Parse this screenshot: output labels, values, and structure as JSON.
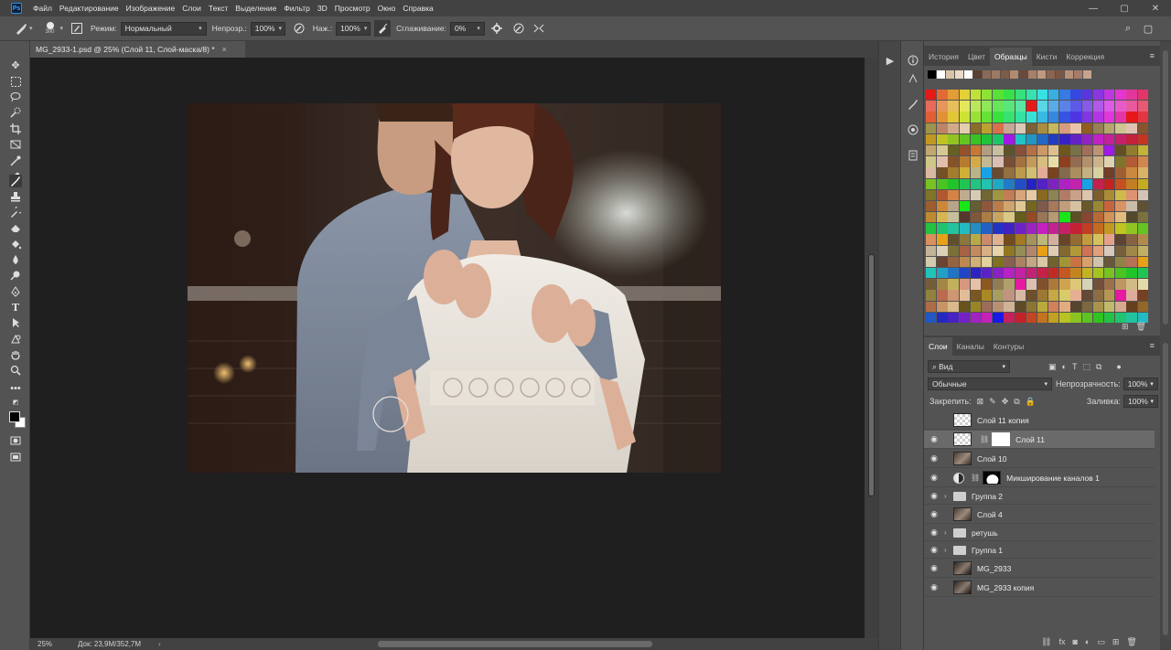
{
  "menubar": {
    "items": [
      "Файл",
      "Редактирование",
      "Изображение",
      "Слои",
      "Текст",
      "Выделение",
      "Фильтр",
      "3D",
      "Просмотр",
      "Окно",
      "Справка"
    ],
    "logo": "Ps"
  },
  "options": {
    "brush_size": "300",
    "mode_label": "Режим:",
    "mode_value": "Нормальный",
    "opacity_label": "Непрозр.:",
    "opacity_value": "100%",
    "pressure_label": "Наж.:",
    "pressure_value": "100%",
    "smoothing_label": "Сглаживание:",
    "smoothing_value": "0%"
  },
  "document": {
    "tab_title": "MG_2933-1.psd @ 25% (Слой 11, Слой-маска/8) *",
    "close": "×"
  },
  "status": {
    "zoom": "25%",
    "doc": "Док: 23,9M/352,7M",
    "arrow": "›"
  },
  "swatches_panel": {
    "tabs": [
      "История",
      "Цвет",
      "Образцы",
      "Кисти",
      "Коррекция"
    ],
    "active_tab": "Образцы",
    "recent_colors": [
      "#000000",
      "#ffffff",
      "#d9c2a8",
      "#e8d9c8",
      "#ffffff",
      "#5a4032",
      "#8a6a58",
      "#9c7a64",
      "#7c5c48",
      "#b08a70",
      "#6a4a3a",
      "#a88068",
      "#c09880",
      "#8c6450",
      "#7a5644",
      "#b89078",
      "#a47c68",
      "#c8a490"
    ]
  },
  "layers_panel": {
    "tabs": [
      "Слои",
      "Каналы",
      "Контуры"
    ],
    "active_tab": "Слои",
    "filter_kind": "Вид",
    "blend_mode": "Обычные",
    "opacity_label": "Непрозрачность:",
    "opacity_value": "100%",
    "lock_label": "Закрепить:",
    "fill_label": "Заливка:",
    "fill_value": "100%",
    "layers": [
      {
        "name": "Слой 11 копия",
        "visible": false,
        "thumb": "check",
        "type": "pixel",
        "selected": false
      },
      {
        "name": "Слой 11",
        "visible": true,
        "thumb": "check",
        "type": "pixel-mask",
        "selected": true
      },
      {
        "name": "Слой 10",
        "visible": true,
        "thumb": "photo",
        "type": "pixel",
        "selected": false
      },
      {
        "name": "Микширование каналов 1",
        "visible": true,
        "thumb": "mask-silhouette",
        "type": "adjustment",
        "selected": false
      },
      {
        "name": "Группа 2",
        "visible": true,
        "thumb": "",
        "type": "group",
        "selected": false
      },
      {
        "name": "Слой 4",
        "visible": true,
        "thumb": "photo",
        "type": "pixel",
        "selected": false
      },
      {
        "name": "ретушь",
        "visible": true,
        "thumb": "",
        "type": "group",
        "selected": false
      },
      {
        "name": "Группа 1",
        "visible": true,
        "thumb": "",
        "type": "group",
        "selected": false
      },
      {
        "name": "MG_2933",
        "visible": true,
        "thumb": "dark",
        "type": "pixel",
        "selected": false
      },
      {
        "name": "MG_2933 копия",
        "visible": true,
        "thumb": "dark",
        "type": "pixel",
        "selected": false
      }
    ]
  },
  "icons": {
    "search": "⌕",
    "workspace": "▢",
    "settings": "⚙",
    "play": "▶"
  }
}
